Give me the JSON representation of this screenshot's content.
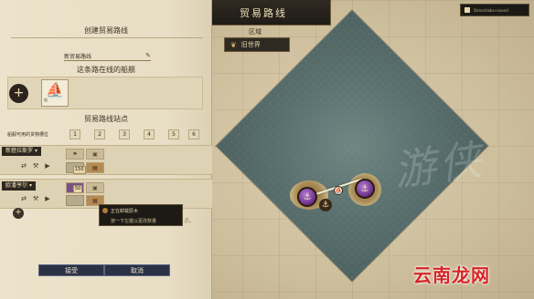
{
  "title": "贸易路线",
  "minimap_label": "Streamlabs+saved",
  "region": {
    "label": "区域",
    "value": "旧世界"
  },
  "panel": {
    "header": "创建贸易路线",
    "route_name_label": "新贸易路线",
    "ships_title": "这条路在线的船舰",
    "add_ship": "+",
    "ship_tag": "船",
    "stops_title": "贸易路线站点",
    "slots_label": "船舰可用的货物槽位",
    "slot_numbers": [
      "1",
      "2",
      "3",
      "4",
      "5",
      "6"
    ]
  },
  "stops": [
    {
      "name": "新窟拉斯罗",
      "qty1": "150",
      "qty2": ""
    },
    {
      "name": "欧潘亨尔",
      "qty1": "50",
      "qty2": ""
    }
  ],
  "add_stop": "+",
  "tooltip": {
    "line1": "正在卸载原木",
    "line2": "按一下左键以更改数量"
  },
  "hint_fragment": "点。",
  "footer": {
    "accept": "接受",
    "cancel": "取消"
  },
  "watermark_map": "游侠",
  "corner_watermark": "云南龙网"
}
